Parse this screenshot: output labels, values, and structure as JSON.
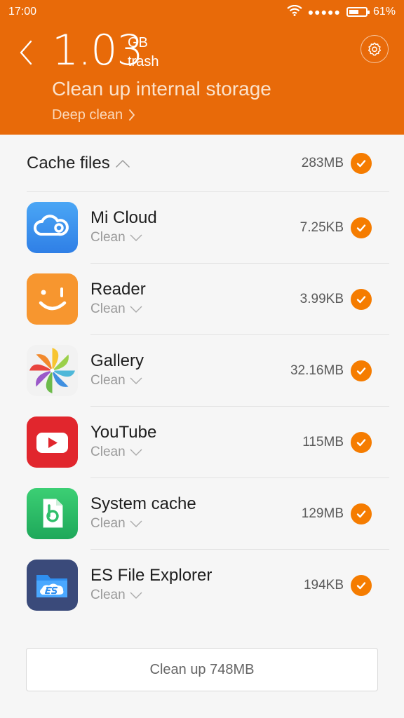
{
  "status_bar": {
    "time": "17:00",
    "battery_percent": "61%",
    "battery_level": 0.61,
    "signal_dots": "●●●●●"
  },
  "header": {
    "size_value": "1.03",
    "size_unit": "GB",
    "size_desc": "trash",
    "title": "Clean up internal storage",
    "deep_clean_label": "Deep clean",
    "background_color": "#e86a09"
  },
  "cache": {
    "title": "Cache files",
    "size": "283MB",
    "checked": true
  },
  "apps": [
    {
      "name": "Mi Cloud",
      "status": "Clean",
      "size": "7.25KB",
      "icon": "mi-cloud-icon",
      "checked": true
    },
    {
      "name": "Reader",
      "status": "Clean",
      "size": "3.99KB",
      "icon": "reader-icon",
      "checked": true
    },
    {
      "name": "Gallery",
      "status": "Clean",
      "size": "32.16MB",
      "icon": "gallery-icon",
      "checked": true
    },
    {
      "name": "YouTube",
      "status": "Clean",
      "size": "115MB",
      "icon": "youtube-icon",
      "checked": true
    },
    {
      "name": "System cache",
      "status": "Clean",
      "size": "129MB",
      "icon": "system-cache-icon",
      "checked": true
    },
    {
      "name": "ES File Explorer",
      "status": "Clean",
      "size": "194KB",
      "icon": "es-file-explorer-icon",
      "checked": true
    }
  ],
  "footer": {
    "clean_button_label": "Clean up 748MB"
  },
  "colors": {
    "accent": "#f57c00",
    "header": "#e86a09"
  }
}
